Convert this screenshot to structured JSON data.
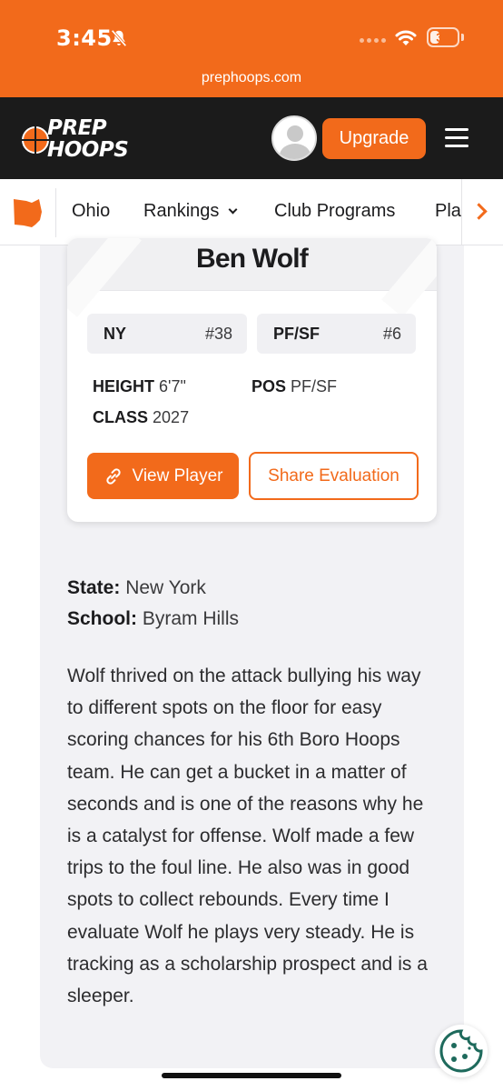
{
  "status_bar": {
    "time": "3:45",
    "battery": "35",
    "battery_level": 0.35,
    "icons": [
      "bell-slash-icon",
      "signal-icon",
      "wifi-icon",
      "battery-icon"
    ]
  },
  "browser": {
    "url": "prephoops.com"
  },
  "header": {
    "logo_line1": "PREP",
    "logo_line2": "HOOPS",
    "upgrade_label": "Upgrade",
    "icons": [
      "avatar-icon",
      "menu-icon"
    ],
    "accent": "#f26a1b",
    "bg": "#1b1b1b"
  },
  "nav": {
    "items": [
      {
        "label": "Ohio"
      },
      {
        "label": "Rankings"
      },
      {
        "label": "Club Programs"
      },
      {
        "label": "Pla"
      }
    ]
  },
  "card": {
    "name": "Ben Wolf",
    "chips": [
      {
        "label": "NY",
        "value": "#38"
      },
      {
        "label": "PF/SF",
        "value": "#6"
      }
    ],
    "height_label": "HEIGHT",
    "height_value": "6'7\"",
    "pos_label": "POS",
    "pos_value": "PF/SF",
    "class_label": "CLASS",
    "class_value": "2027",
    "view_label": "View Player",
    "share_label": "Share Evaluation"
  },
  "info": {
    "state_label": "State:",
    "state_value": "New York",
    "school_label": "School:",
    "school_value": "Byram Hills"
  },
  "description": "Wolf thrived on the attack bullying his way to different spots on the floor for easy scoring chances for his 6th Boro Hoops team. He can get a bucket in a matter of seconds and is one of the reasons why he is a catalyst for offense. Wolf made a few trips to the foul line. He also was in good spots to collect rebounds. Every time I evaluate Wolf he plays very steady. He is tracking as a scholarship prospect and is a sleeper."
}
